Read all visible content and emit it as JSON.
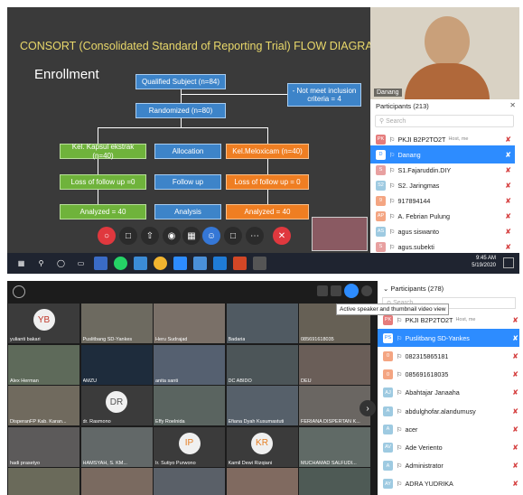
{
  "top": {
    "slide": {
      "title": "CONSORT (Consolidated Standard of Reporting Trial)  FLOW DIAGRAM",
      "enrollment": "Enrollment",
      "qualified": "Qualified Subject (n=84)",
      "not_meet": "- Not meet inclusion criteria = 4",
      "randomized": "Randomized (n=80)",
      "left_group": "Kel. Kapsul ekstrak (n=40)",
      "allocation": "Allocation",
      "right_group": "Kel.Meloxicam (n=40)",
      "left_loss": "Loss of follow up =0",
      "follow_up": "Follow up",
      "right_loss": "Loss of follow up = 0",
      "left_analyzed": "Analyzed = 40",
      "analysis": "Analysis",
      "right_analyzed": "Analyzed = 40"
    },
    "camera_name": "Danang",
    "participants": {
      "header": "Participants (213)",
      "search_placeholder": "Search",
      "rows": [
        {
          "initials": "PK",
          "name": "PKJI B2P2TO2T",
          "sub": "Host, me",
          "color": "#e57c7c"
        },
        {
          "initials": "D",
          "name": "Danang",
          "sub": "",
          "color": "#ffffff"
        },
        {
          "initials": "S",
          "name": "S1.Fajaruddin.DIY",
          "sub": "",
          "color": "#e8a0a0"
        },
        {
          "initials": "S2",
          "name": "S2. Jaringmas",
          "sub": "",
          "color": "#9ecae1"
        },
        {
          "initials": "9",
          "name": "917894144",
          "sub": "",
          "color": "#f4a582"
        },
        {
          "initials": "AP",
          "name": "A. Febrian Pulung",
          "sub": "",
          "color": "#f4a582"
        },
        {
          "initials": "AS",
          "name": "agus siswanto",
          "sub": "",
          "color": "#9ecae1"
        },
        {
          "initials": "S",
          "name": "agus.subekti",
          "sub": "",
          "color": "#e8a0a0"
        }
      ]
    },
    "taskbar": {
      "time": "9:45 AM",
      "date": "5/19/2020"
    }
  },
  "bottom": {
    "tooltip": "Active speaker and thumbnail video view",
    "tiles": [
      {
        "name": "yulianti bakari",
        "initials": "YB",
        "color": "#c0392b"
      },
      {
        "name": "Puslitbang SD-Yankes",
        "initials": "",
        "color": ""
      },
      {
        "name": "Heru Sudrajad",
        "initials": "",
        "color": ""
      },
      {
        "name": "Badaria",
        "initials": "",
        "color": ""
      },
      {
        "name": "085691618035",
        "initials": "",
        "color": ""
      },
      {
        "name": "Alex Herman",
        "initials": "",
        "color": ""
      },
      {
        "name": "AMZU",
        "initials": "",
        "color": ""
      },
      {
        "name": "anita santi",
        "initials": "",
        "color": ""
      },
      {
        "name": "DC ABIDO",
        "initials": "",
        "color": ""
      },
      {
        "name": "DEU",
        "initials": "",
        "color": ""
      },
      {
        "name": "DisperanFP Kab. Karan...",
        "initials": "",
        "color": ""
      },
      {
        "name": "dr. Rasmono",
        "initials": "DR",
        "color": "#555555"
      },
      {
        "name": "Effy Roelnida",
        "initials": "",
        "color": ""
      },
      {
        "name": "Efiana Dyah Kusumastuti",
        "initials": "",
        "color": ""
      },
      {
        "name": "FERIANA DISPERTAN K...",
        "initials": "",
        "color": ""
      },
      {
        "name": "hadi prasetyo",
        "initials": "",
        "color": ""
      },
      {
        "name": "HAMSYAH, S. KM...",
        "initials": "",
        "color": ""
      },
      {
        "name": "Ir. Sutiyo Purwono",
        "initials": "IP",
        "color": "#e67e22"
      },
      {
        "name": "Kamil Dewi Rizqiani",
        "initials": "KR",
        "color": "#e67e22"
      },
      {
        "name": "MUCHAMAD SALFUDI...",
        "initials": "",
        "color": ""
      }
    ],
    "participants": {
      "header": "Participants (278)",
      "search_placeholder": "Search",
      "rows": [
        {
          "initials": "PK",
          "name": "PKJI B2P2TO2T",
          "sub": "Host, me",
          "color": "#e57c7c"
        },
        {
          "initials": "PS",
          "name": "Puslitbang SD-Yankes",
          "sub": "",
          "color": "#ffffff"
        },
        {
          "initials": "0",
          "name": "082315865181",
          "sub": "",
          "color": "#f4a582"
        },
        {
          "initials": "0",
          "name": "085691618035",
          "sub": "",
          "color": "#f4a582"
        },
        {
          "initials": "AJ",
          "name": "Abahtajar Janaaha",
          "sub": "",
          "color": "#9ecae1"
        },
        {
          "initials": "A",
          "name": "abdulghofar.alandumusy",
          "sub": "",
          "color": "#9ecae1"
        },
        {
          "initials": "A",
          "name": "acer",
          "sub": "",
          "color": "#9ecae1"
        },
        {
          "initials": "AV",
          "name": "Ade Veriento",
          "sub": "",
          "color": "#9ecae1"
        },
        {
          "initials": "A",
          "name": "Administrator",
          "sub": "",
          "color": "#9ecae1"
        },
        {
          "initials": "AY",
          "name": "ADRA YUDRIKA",
          "sub": "",
          "color": "#9ecae1"
        }
      ]
    }
  }
}
